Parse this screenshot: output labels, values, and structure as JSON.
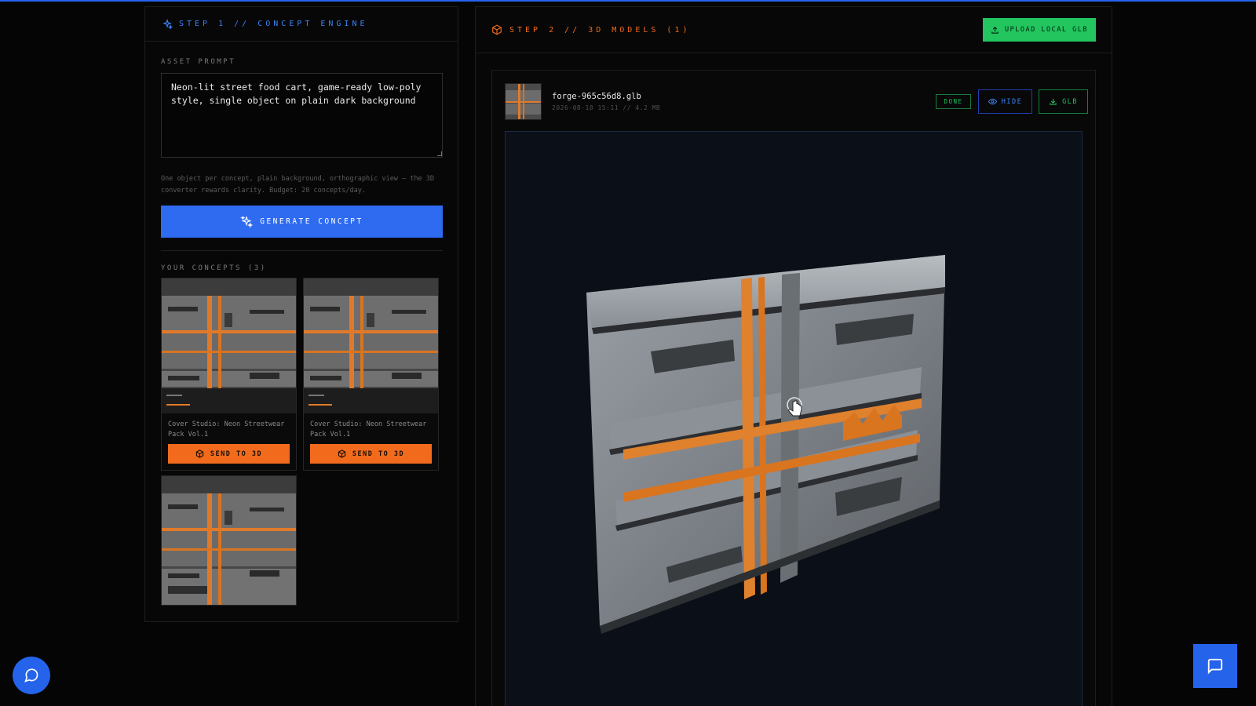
{
  "step1": {
    "title": "STEP 1 // CONCEPT ENGINE",
    "prompt_label": "ASSET PROMPT",
    "prompt_value": "Neon-lit street food cart, game-ready low-poly style, single object on plain dark background",
    "hint": "One object per concept, plain background, orthographic view — the 3D converter rewards clarity. Budget: 20 concepts/day.",
    "generate_label": "GENERATE CONCEPT",
    "concepts_label": "YOUR CONCEPTS (3)",
    "concepts": [
      {
        "title": "Cover Studio: Neon Streetwear Pack Vol.1",
        "send_label": "SEND TO 3D"
      },
      {
        "title": "Cover Studio: Neon Streetwear Pack Vol.1",
        "send_label": "SEND TO 3D"
      },
      {
        "title": "",
        "send_label": ""
      }
    ]
  },
  "step2": {
    "title": "STEP 2 // 3D MODELS (1)",
    "upload_label": "UPLOAD LOCAL GLB",
    "model": {
      "filename": "forge-965c56d8.glb",
      "meta": "2026-08-18 15:11 // 4.2 MB",
      "status": "DONE",
      "hide_label": "HIDE",
      "download_label": "GLB"
    }
  },
  "colors": {
    "accent_blue": "#2563eb",
    "accent_orange": "#f26b1d",
    "accent_green": "#22c55e"
  },
  "icons": [
    "sparkles-icon",
    "cube-icon",
    "upload-icon",
    "eye-icon",
    "download-icon",
    "chat-icon"
  ]
}
